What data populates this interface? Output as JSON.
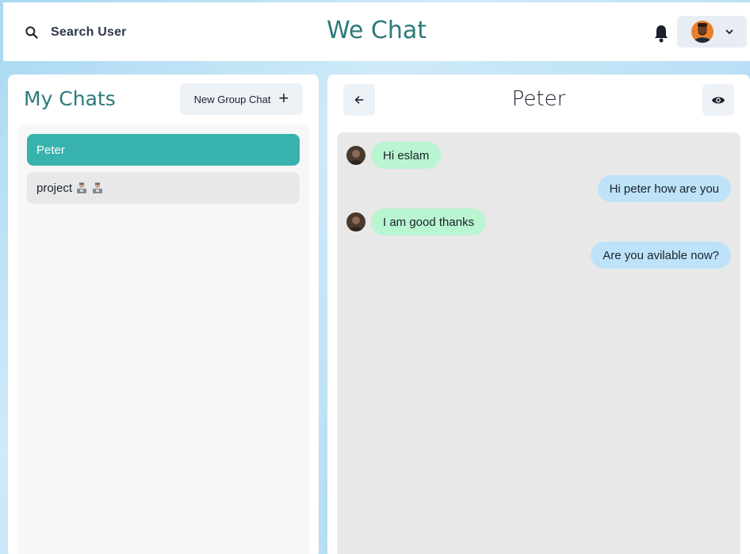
{
  "header": {
    "search_label": "Search User",
    "app_title": "We Chat",
    "notification_icon": "bell-icon",
    "profile_chevron_icon": "chevron-down-icon"
  },
  "sidebar": {
    "title": "My Chats",
    "new_group_label": "New Group Chat",
    "new_group_icon": "+",
    "chats": [
      {
        "name": "Peter",
        "active": true
      },
      {
        "name": "project",
        "active": false
      }
    ]
  },
  "chat": {
    "title": "Peter",
    "messages": [
      {
        "text": "Hi eslam",
        "from": "other"
      },
      {
        "text": "Hi peter how are you",
        "from": "self"
      },
      {
        "text": "I am good thanks",
        "from": "other"
      },
      {
        "text": "Are you avilable now?",
        "from": "self"
      }
    ]
  },
  "colors": {
    "accent": "#2c7a7b",
    "active_chat": "#38b2ac",
    "incoming_bubble": "#b9f5d0",
    "outgoing_bubble": "#bee3f8"
  }
}
